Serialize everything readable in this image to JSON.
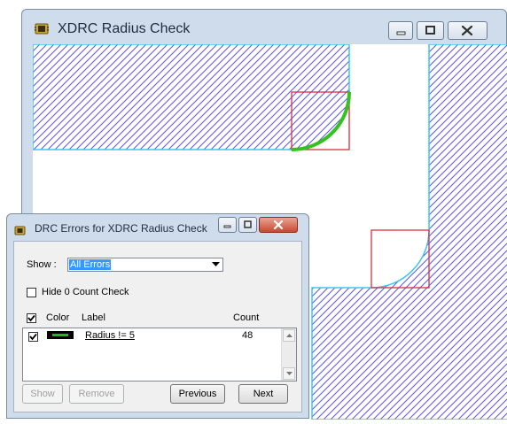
{
  "main_window": {
    "title": "XDRC Radius Check",
    "colors": {
      "hatch": "#5a55e8",
      "outline": "#3cc8e8",
      "error_box": "#d83040",
      "error_arc": "#33c21e"
    }
  },
  "dialog": {
    "title": "DRC Errors for XDRC Radius Check",
    "show_label": "Show :",
    "show_value": "All Errors",
    "hide_zero_label": "Hide 0 Count Check",
    "hide_zero_checked": false,
    "columns": {
      "color": "Color",
      "label": "Label",
      "count": "Count"
    },
    "header_checked": true,
    "rows": [
      {
        "checked": true,
        "color": "#1fb81f",
        "label": "Radius != 5",
        "count": "48"
      }
    ],
    "buttons": {
      "show": "Show",
      "remove": "Remove",
      "previous": "Previous",
      "next": "Next"
    }
  }
}
